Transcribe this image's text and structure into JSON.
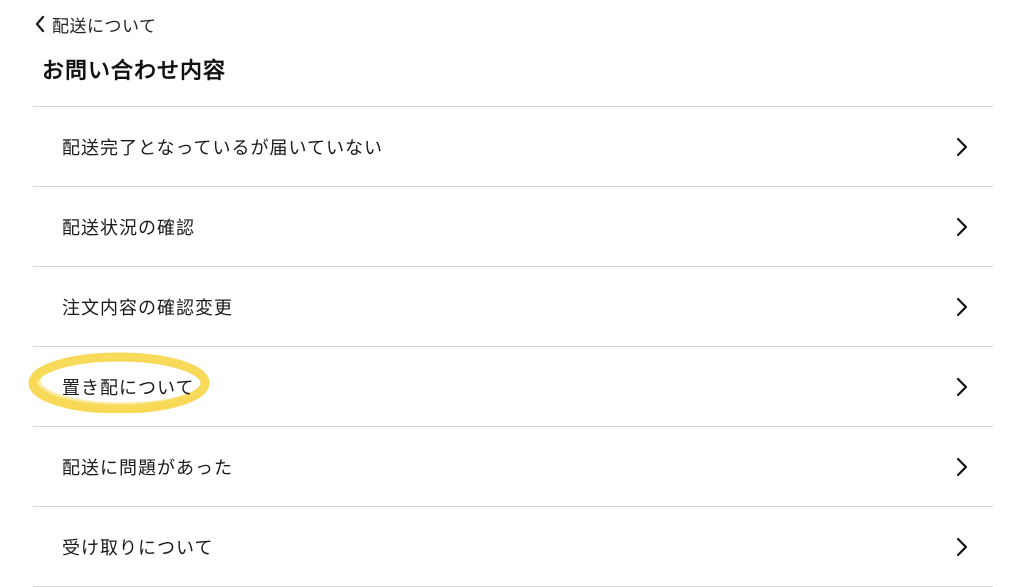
{
  "header": {
    "back_label": "配送について",
    "title": "お問い合わせ内容"
  },
  "menu": {
    "items": [
      {
        "label": "配送完了となっているが届いていない"
      },
      {
        "label": "配送状況の確認"
      },
      {
        "label": "注文内容の確認変更"
      },
      {
        "label": "置き配について",
        "highlighted": true
      },
      {
        "label": "配送に問題があった"
      },
      {
        "label": "受け取りについて"
      }
    ]
  },
  "colors": {
    "highlight": "#f7d23a",
    "divider": "#d6d6d6",
    "text": "#1a1a1a"
  },
  "icons": {
    "back": "chevron-left-icon",
    "row": "chevron-right-icon"
  }
}
